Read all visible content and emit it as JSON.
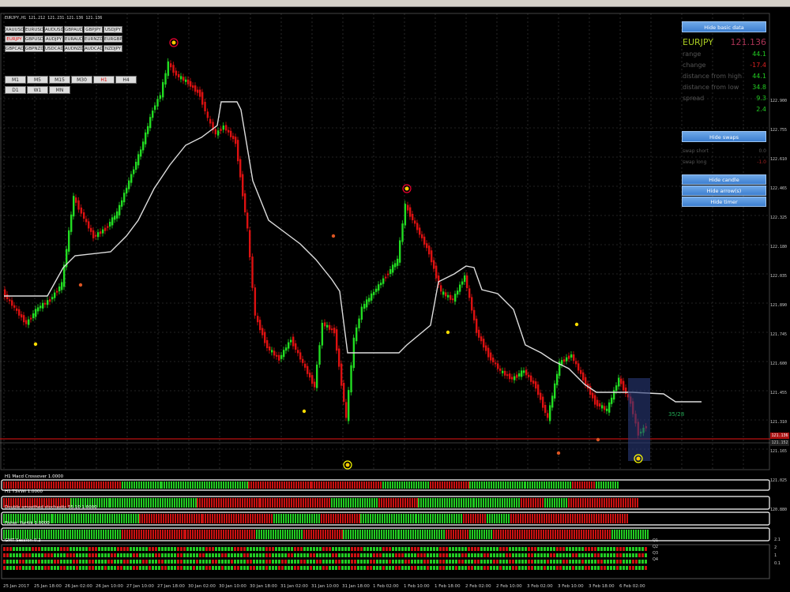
{
  "toolbar": {
    "timeframes": [
      "M1",
      "M5",
      "M15",
      "M30",
      "H1",
      "H4",
      "D1",
      "W1",
      "MN"
    ]
  },
  "chart": {
    "title": "EURJPY,H1  121.212 121.231 121.136 121.136",
    "bid_line_label": "35/28",
    "current_price": "121.136",
    "current_price2": "121.152"
  },
  "symbols": [
    [
      "XAUUSD",
      "EURUSD",
      "AUDUSD",
      "GBPAUD",
      "GBPJPY",
      "USDJPY"
    ],
    [
      "EURJPY",
      "GBPUSD",
      "AUDJPY",
      "EURAUD",
      "EURNZD",
      "EURGBP"
    ],
    [
      "GBPCAD",
      "GBPNZD",
      "USDCAD",
      "AUDNZD",
      "AUDCAD",
      "NZDJPY"
    ]
  ],
  "active_symbol": "EURJPY",
  "timeframes": [
    [
      "M1",
      "M5",
      "M15",
      "M30",
      "H1",
      "H4"
    ],
    [
      "D1",
      "W1",
      "MN"
    ]
  ],
  "active_timeframe": "H1",
  "panel": {
    "hide_basic_data": "Hide basic data",
    "symbol": "EURJPY",
    "price": "121.136",
    "rows": [
      {
        "label": "range",
        "value": "44.1",
        "color": "#22cc22"
      },
      {
        "label": "change",
        "value": "-17.4",
        "color": "#dd2222"
      },
      {
        "label": "distance from high",
        "value": "44.1",
        "color": "#22cc22"
      },
      {
        "label": "distance from low",
        "value": "34.8",
        "color": "#22cc22"
      },
      {
        "label": "spread",
        "value": "9.3",
        "color": "#22cc22"
      },
      {
        "label": "",
        "value": "2.4",
        "color": "#22cc22"
      }
    ],
    "hide_swaps": "Hide swaps",
    "swap_short_label": "swap short",
    "swap_short_value": "0.0",
    "swap_long_label": "swap long",
    "swap_long_value": "-1.0",
    "hide_candle": "Hide candle",
    "hide_arrows": "Hide arrow(s)",
    "hide_timer": "Hide timer"
  },
  "price_axis": [
    "122.900",
    "122.755",
    "122.610",
    "122.465",
    "122.325",
    "122.180",
    "122.035",
    "121.890",
    "121.745",
    "121.600",
    "121.455",
    "121.310",
    "121.165",
    "121.025",
    "120.880"
  ],
  "time_axis": [
    "25 Jan 2017",
    "25 Jan 18:00",
    "26 Jan 02:00",
    "26 Jan 10:00",
    "27 Jan 10:00",
    "27 Jan 18:00",
    "30 Jan 02:00",
    "30 Jan 10:00",
    "30 Jan 18:00",
    "31 Jan 02:00",
    "31 Jan 10:00",
    "31 Jan 18:00",
    "1 Feb 02:00",
    "1 Feb 10:00",
    "1 Feb 18:00",
    "2 Feb 02:00",
    "2 Feb 10:00",
    "3 Feb 02:00",
    "3 Feb 10:00",
    "3 Feb 18:00",
    "6 Feb 02:00"
  ],
  "indicators": [
    "H1 Macd Crossover 1.0000",
    "H1 TSVWI 1.0000",
    "Double smoothed stochastic 55.10 1.0000",
    "Fisher_Yur4ik 1.0000",
    "GMT Session 0.2"
  ],
  "side_labels": [
    "Q1",
    "Q2",
    "Q3",
    "Q4"
  ],
  "ind_axis": [
    "2.1",
    "2",
    "1",
    "0.1"
  ],
  "colors": {
    "bull": "#22dd22",
    "bear": "#dd1111",
    "grid": "#444444",
    "ma": "#dddddd",
    "accent": "#4a8be0"
  }
}
